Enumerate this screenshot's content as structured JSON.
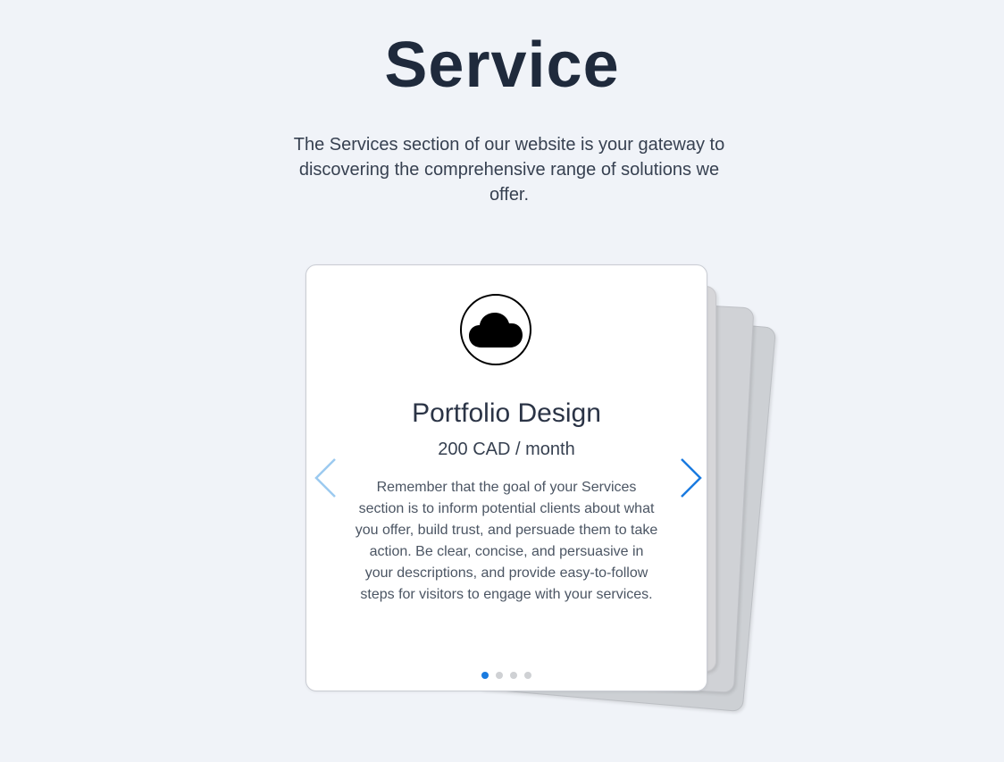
{
  "page": {
    "title": "Service",
    "intro": "The Services section of our website is your gateway to discovering the comprehensive range of solutions we offer."
  },
  "carousel": {
    "active_index": 0,
    "slide_count": 4,
    "active_card": {
      "icon": "cloud-icon",
      "title": "Portfolio Design",
      "price": "200 CAD / month",
      "description": "Remember that the goal of your Services section is to inform potential clients about what you offer, build trust, and persuade them to take action. Be clear, concise, and persuasive in your descriptions, and provide easy-to-follow steps for visitors to engage with your services."
    },
    "prev_icon": "chevron-left-icon",
    "next_icon": "chevron-right-icon"
  },
  "colors": {
    "background": "#f0f3f8",
    "accent": "#1a7be0",
    "prev_arrow": "#9ccaf0",
    "title": "#1f2a3c"
  }
}
